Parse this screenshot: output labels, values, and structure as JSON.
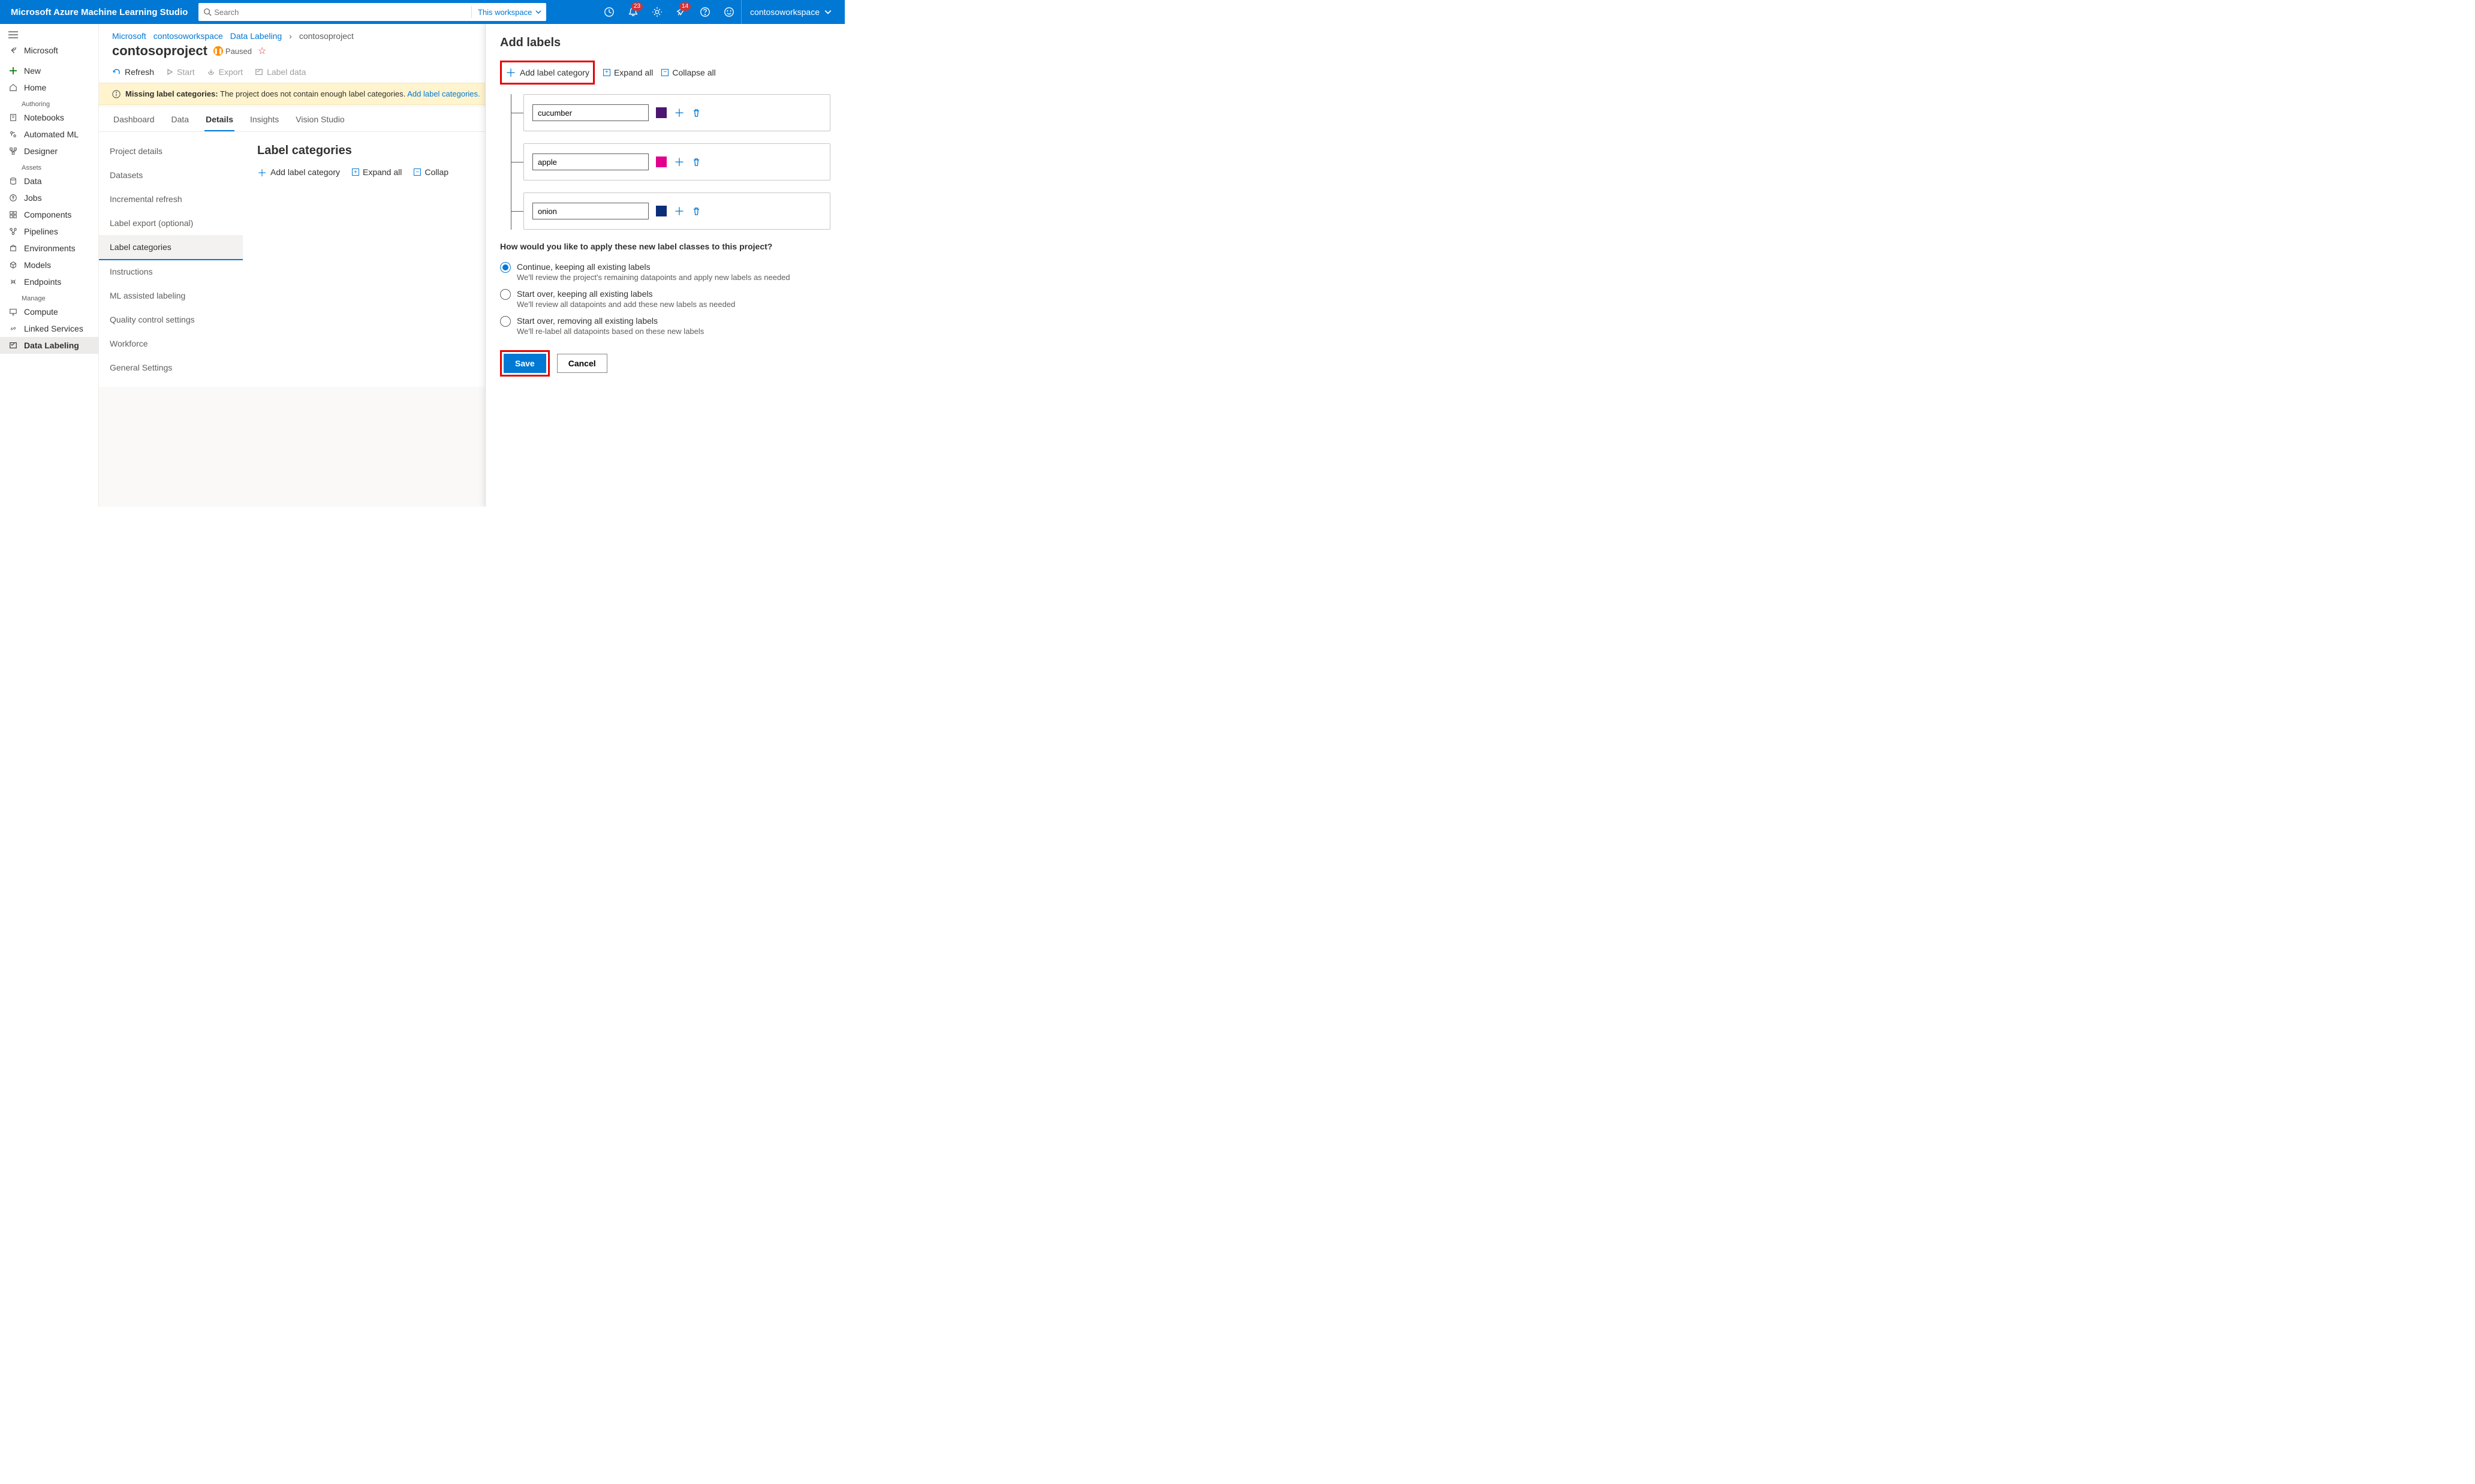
{
  "brand": "Microsoft Azure Machine Learning Studio",
  "search": {
    "placeholder": "Search",
    "scope": "This workspace"
  },
  "topbar": {
    "notifications_badge": "23",
    "feedback_badge": "14",
    "workspace": "contosoworkspace"
  },
  "sidebar": {
    "back_label": "Microsoft",
    "new": "New",
    "home": "Home",
    "section_authoring": "Authoring",
    "notebooks": "Notebooks",
    "automl": "Automated ML",
    "designer": "Designer",
    "section_assets": "Assets",
    "data": "Data",
    "jobs": "Jobs",
    "components": "Components",
    "pipelines": "Pipelines",
    "environments": "Environments",
    "models": "Models",
    "endpoints": "Endpoints",
    "section_manage": "Manage",
    "compute": "Compute",
    "linked": "Linked Services",
    "labeling": "Data Labeling"
  },
  "breadcrumb": {
    "microsoft": "Microsoft",
    "workspace": "contosoworkspace",
    "labeling": "Data Labeling",
    "project": "contosoproject"
  },
  "title": {
    "name": "contosoproject",
    "status": "Paused"
  },
  "toolbar": {
    "refresh": "Refresh",
    "start": "Start",
    "export": "Export",
    "label_data": "Label data"
  },
  "banner": {
    "prefix": "Missing label categories:",
    "msg": "The project does not contain enough label categories.",
    "link": "Add label categories."
  },
  "tabs": {
    "dashboard": "Dashboard",
    "data": "Data",
    "details": "Details",
    "insights": "Insights",
    "vision": "Vision Studio",
    "active": "details"
  },
  "subnav": {
    "project_details": "Project details",
    "datasets": "Datasets",
    "incremental": "Incremental refresh",
    "export": "Label export (optional)",
    "categories": "Label categories",
    "instructions": "Instructions",
    "ml_assist": "ML assisted labeling",
    "quality": "Quality control settings",
    "workforce": "Workforce",
    "general": "General Settings"
  },
  "detail": {
    "heading": "Label categories",
    "add": "Add label category",
    "expand": "Expand all",
    "collapse": "Collap"
  },
  "flyout": {
    "title": "Add labels",
    "add": "Add label category",
    "expand": "Expand all",
    "collapse": "Collapse all",
    "labels": [
      {
        "name": "cucumber",
        "color": "#4b1570"
      },
      {
        "name": "apple",
        "color": "#e3008c"
      },
      {
        "name": "onion",
        "color": "#0b2e7a"
      }
    ],
    "radio_q": "How would you like to apply these new label classes to this project?",
    "opts": [
      {
        "title": "Continue, keeping all existing labels",
        "sub": "We'll review the project's remaining datapoints and apply new labels as needed"
      },
      {
        "title": "Start over, keeping all existing labels",
        "sub": "We'll review all datapoints and add these new labels as needed"
      },
      {
        "title": "Start over, removing all existing labels",
        "sub": "We'll re-label all datapoints based on these new labels"
      }
    ],
    "save": "Save",
    "cancel": "Cancel"
  }
}
